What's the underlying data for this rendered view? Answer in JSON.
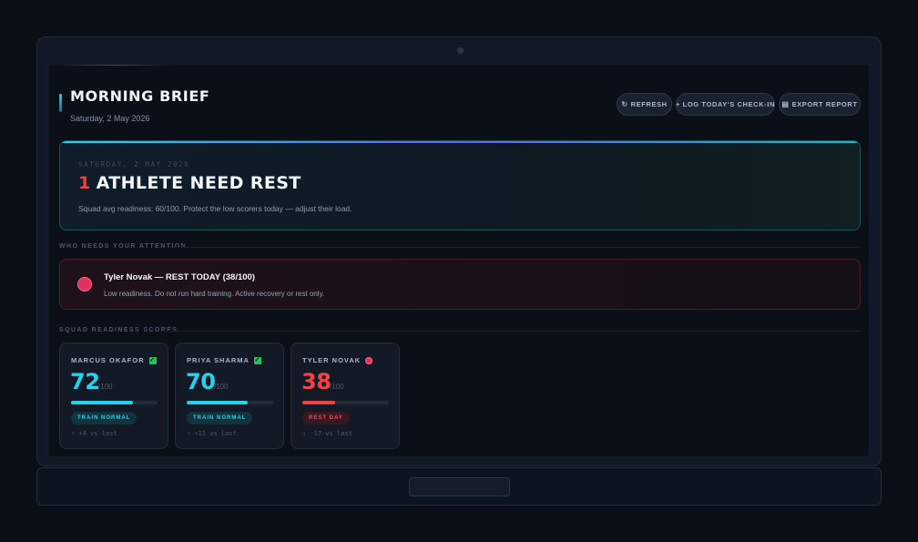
{
  "header": {
    "title": "MORNING BRIEF",
    "date": "Saturday, 2 May 2026",
    "buttons": {
      "refresh": "REFRESH",
      "log": "+ LOG TODAY'S CHECK-IN",
      "export": "EXPORT REPORT"
    }
  },
  "hero": {
    "date": "SATURDAY, 2 MAY 2026",
    "count": "1",
    "headline": "ATHLETE NEED REST",
    "subtitle": "Squad avg readiness: 60/100. Protect the low scorers today — adjust their load."
  },
  "attention": {
    "label": "WHO NEEDS YOUR ATTENTION",
    "alert_title": "Tyler Novak — REST TODAY (38/100)",
    "alert_text": "Low readiness. Do not run hard training. Active recovery or rest only."
  },
  "squad": {
    "label": "SQUAD READINESS SCORES",
    "athletes": [
      {
        "name": "MARCUS OKAFOR",
        "score": "72",
        "max": "/100",
        "status": "TRAIN NORMAL",
        "delta": "↑ +4 vs last",
        "readiness": 72,
        "color": "#22d3ee",
        "flag": "check"
      },
      {
        "name": "PRIYA SHARMA",
        "score": "70",
        "max": "/100",
        "status": "TRAIN NORMAL",
        "delta": "↑ +11 vs last",
        "readiness": 70,
        "color": "#22d3ee",
        "flag": "check"
      },
      {
        "name": "TYLER NOVAK",
        "score": "38",
        "max": "/100",
        "status": "REST DAY",
        "delta": "↓ -17 vs last",
        "readiness": 38,
        "color": "#ef4444",
        "flag": "alert"
      }
    ]
  },
  "colors": {
    "accent": "#22d3ee",
    "danger": "#ef4444",
    "success": "#22c55e"
  }
}
